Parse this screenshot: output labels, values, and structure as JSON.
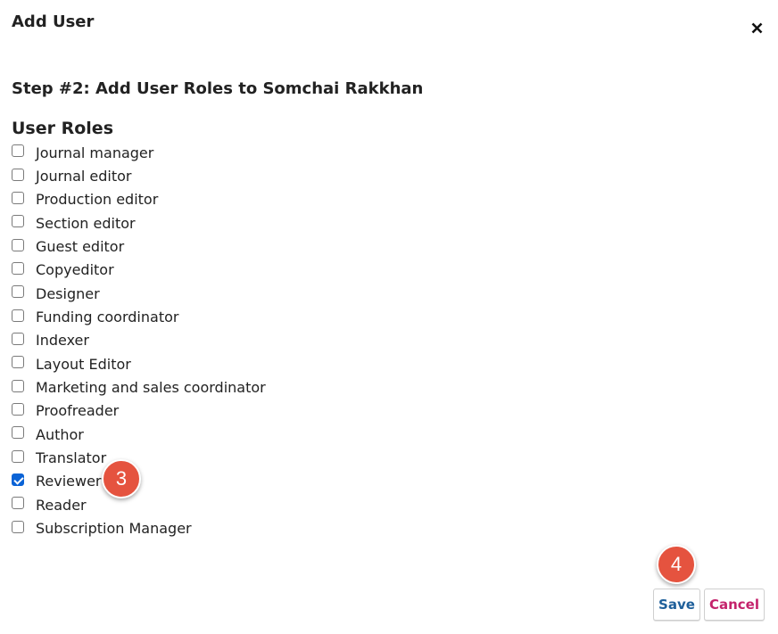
{
  "modal": {
    "title": "Add User",
    "close_icon": "close-icon"
  },
  "step": {
    "title": "Step #2: Add User Roles to Somchai Rakkhan"
  },
  "roles_section": {
    "title": "User Roles",
    "roles": [
      {
        "label": "Journal manager",
        "checked": false
      },
      {
        "label": "Journal editor",
        "checked": false
      },
      {
        "label": "Production editor",
        "checked": false
      },
      {
        "label": "Section editor",
        "checked": false
      },
      {
        "label": "Guest editor",
        "checked": false
      },
      {
        "label": "Copyeditor",
        "checked": false
      },
      {
        "label": "Designer",
        "checked": false
      },
      {
        "label": "Funding coordinator",
        "checked": false
      },
      {
        "label": "Indexer",
        "checked": false
      },
      {
        "label": "Layout Editor",
        "checked": false
      },
      {
        "label": "Marketing and sales coordinator",
        "checked": false
      },
      {
        "label": "Proofreader",
        "checked": false
      },
      {
        "label": "Author",
        "checked": false
      },
      {
        "label": "Translator",
        "checked": false
      },
      {
        "label": "Reviewer",
        "checked": true
      },
      {
        "label": "Reader",
        "checked": false
      },
      {
        "label": "Subscription Manager",
        "checked": false
      }
    ]
  },
  "annotations": {
    "badge_reviewer": "3",
    "badge_save": "4",
    "badge_color": "#e5533f"
  },
  "footer": {
    "save_label": "Save",
    "cancel_label": "Cancel",
    "save_color": "#1e5f9a",
    "cancel_color": "#c4236c"
  }
}
